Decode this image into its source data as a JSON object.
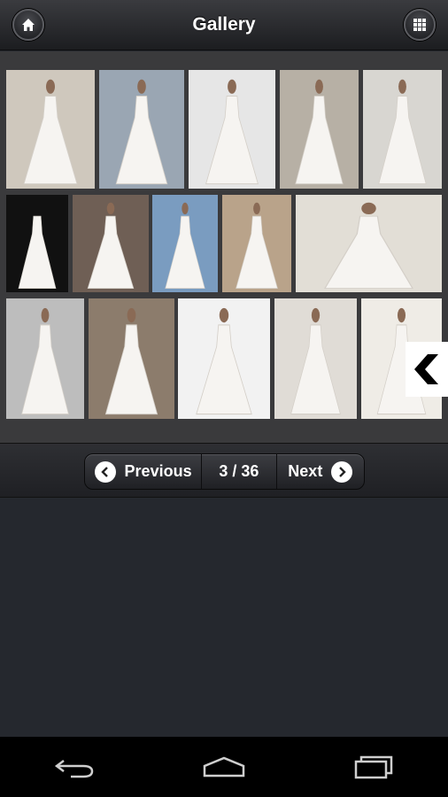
{
  "header": {
    "title": "Gallery",
    "home_icon": "home-icon",
    "grid_icon": "grid-icon"
  },
  "gallery": {
    "thumbnails": [
      {
        "name": "thumbnail-1",
        "bg": "#cfc8bd"
      },
      {
        "name": "thumbnail-2",
        "bg": "#9aa6b3"
      },
      {
        "name": "thumbnail-3",
        "bg": "#e6e6e6"
      },
      {
        "name": "thumbnail-4",
        "bg": "#b7b0a5"
      },
      {
        "name": "thumbnail-5",
        "bg": "#d8d6d1"
      },
      {
        "name": "thumbnail-6",
        "bg": "#111111"
      },
      {
        "name": "thumbnail-7",
        "bg": "#6f5f55"
      },
      {
        "name": "thumbnail-8",
        "bg": "#7a9cc0"
      },
      {
        "name": "thumbnail-9",
        "bg": "#b9a38a"
      },
      {
        "name": "thumbnail-10",
        "bg": "#e2ded6"
      },
      {
        "name": "thumbnail-11",
        "bg": "#bdbdbd"
      },
      {
        "name": "thumbnail-12",
        "bg": "#8c7c6c"
      },
      {
        "name": "thumbnail-13",
        "bg": "#f2f2f2"
      },
      {
        "name": "thumbnail-14",
        "bg": "#e0dcd6"
      },
      {
        "name": "thumbnail-15",
        "bg": "#efece6"
      }
    ],
    "side_tab_icon": "chevron-left-icon"
  },
  "pager": {
    "previous_label": "Previous",
    "page_indicator": "3 / 36",
    "next_label": "Next"
  },
  "navbar": {
    "back_icon": "back-icon",
    "home_icon": "home-outline-icon",
    "recents_icon": "recent-apps-icon"
  },
  "colors": {
    "background": "#25282e",
    "gallery_panel": "#3a3a3c",
    "header_text": "#ffffff"
  }
}
